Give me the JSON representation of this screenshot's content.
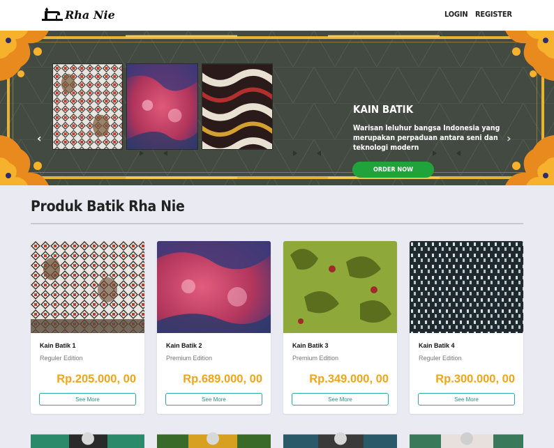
{
  "navbar": {
    "logo_text": "Rha Nie",
    "login": "LOGIN",
    "register": "REGISTER"
  },
  "hero": {
    "title": "KAIN BATIK",
    "subtitle": "Warisan leluhur bangsa Indonesia yang merupakan perpaduan antara seni dan teknologi modern",
    "button": "ORDER NOW",
    "prev_icon": "‹",
    "next_icon": "›"
  },
  "section": {
    "title": "Produk Batik Rha Nie"
  },
  "products": [
    {
      "name": "Kain Batik 1",
      "edition": "Reguler Edition",
      "price": "Rp.205.000, 00",
      "button": "See More"
    },
    {
      "name": "Kain Batik 2",
      "edition": "Premium Edition",
      "price": "Rp.689.000, 00",
      "button": "See More"
    },
    {
      "name": "Kain Batik 3",
      "edition": "Premium Edition",
      "price": "Rp.349.000, 00",
      "button": "See More"
    },
    {
      "name": "Kain Batik 4",
      "edition": "Reguler Edition",
      "price": "Rp.300.000, 00",
      "button": "See More"
    }
  ],
  "colors": {
    "accent": "#f2a515",
    "order_button": "#21a33b",
    "hero_bg": "#424a42",
    "frame": "#e8b234"
  }
}
